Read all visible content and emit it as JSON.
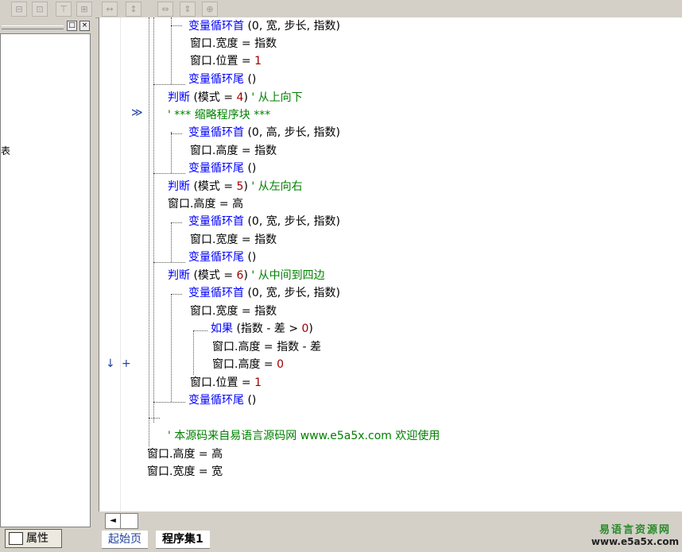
{
  "toolbar": {
    "buttons": [
      "align-left-icon",
      "align-center-icon",
      "align-top-icon",
      "align-middle-icon",
      "space-h-icon",
      "space-v-icon",
      "same-width-icon",
      "same-height-icon",
      "same-size-icon"
    ]
  },
  "left_panel": {
    "fragment": "表",
    "attr_tab_label": "属性"
  },
  "code": {
    "l1": {
      "kw": "变量循环首",
      "rest": " (0, 宽, 步长, 指数)"
    },
    "l2": {
      "text": "窗口.宽度 = 指数"
    },
    "l3": {
      "text": "窗口.位置 = ",
      "num": "1"
    },
    "l4": {
      "kw": "变量循环尾",
      "rest": " ()"
    },
    "l5": {
      "kw": "判断",
      "rest": " (模式 = ",
      "num": "4",
      "close": ")",
      "comment": "  ' 从上向下"
    },
    "l6": {
      "comment": "' *** 缩略程序块 ***"
    },
    "l7": {
      "kw": "变量循环首",
      "rest": " (0, 高, 步长, 指数)"
    },
    "l8": {
      "text": "窗口.高度 = 指数"
    },
    "l9": {
      "kw": "变量循环尾",
      "rest": " ()"
    },
    "l10": {
      "kw": "判断",
      "rest": " (模式 = ",
      "num": "5",
      "close": ")",
      "comment": "  ' 从左向右"
    },
    "l11": {
      "text": "窗口.高度 = 高"
    },
    "l12": {
      "kw": "变量循环首",
      "rest": " (0, 宽, 步长, 指数)"
    },
    "l13": {
      "text": "窗口.宽度 = 指数"
    },
    "l14": {
      "kw": "变量循环尾",
      "rest": " ()"
    },
    "l15": {
      "kw": "判断",
      "rest": " (模式 = ",
      "num": "6",
      "close": ")",
      "comment": "  ' 从中间到四边"
    },
    "l16": {
      "kw": "变量循环首",
      "rest": " (0, 宽, 步长, 指数)"
    },
    "l17": {
      "text": "窗口.宽度 = 指数"
    },
    "l18": {
      "kw": "如果",
      "rest": " (指数 - 差 > ",
      "num": "0",
      "close": ")"
    },
    "l19": {
      "text": "窗口.高度 = 指数 - 差"
    },
    "l20": {
      "text": "窗口.高度 = ",
      "num": "0"
    },
    "l21": {
      "text": "窗口.位置 = ",
      "num": "1"
    },
    "l22": {
      "kw": "变量循环尾",
      "rest": " ()"
    },
    "l23": {
      "comment": "' 本源码来自易语言源码网 www.e5a5x.com  欢迎使用"
    },
    "l24": {
      "text": "窗口.高度 = 高"
    },
    "l25": {
      "text": "窗口.宽度 = 宽"
    }
  },
  "gutter": {
    "collapse_marker": "≫",
    "down_arrow": "↓",
    "plus": "+"
  },
  "tabs": [
    {
      "label": "起始页"
    },
    {
      "label": "程序集1"
    }
  ],
  "watermark": {
    "line1": "易语言资源网",
    "line2": "www.e5a5x.com"
  },
  "colors": {
    "keyword": "#0000ff",
    "comment": "#008000",
    "number": "#a00000"
  }
}
